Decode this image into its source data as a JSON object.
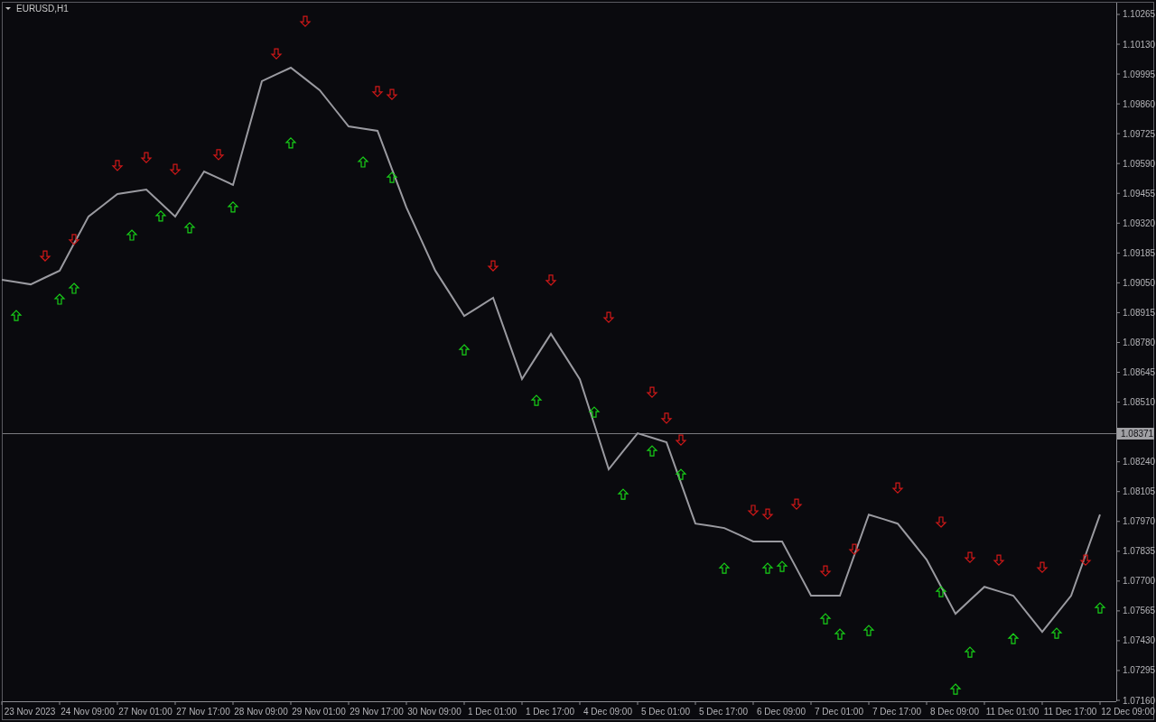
{
  "chart": {
    "chart_data": {
      "type": "line",
      "title": "EURUSD,H1",
      "categories": [
        null,
        null,
        "23 Nov 2023",
        null,
        null,
        null,
        "24 Nov 09:00",
        null,
        null,
        null,
        "27 Nov 01:00",
        null,
        null,
        null,
        "27 Nov 17:00",
        null,
        null,
        null,
        "28 Nov 09:00",
        null,
        null,
        null,
        "29 Nov 01:00",
        null,
        null,
        null,
        "29 Nov 17:00",
        null,
        null,
        null,
        "30 Nov 09:00",
        null,
        null,
        null,
        "1 Dec 01:00",
        null,
        null,
        null,
        "1 Dec 17:00",
        null,
        null,
        null,
        "4 Dec 09:00",
        null,
        null,
        null,
        "5 Dec 01:00",
        null,
        null,
        null,
        "5 Dec 17:00",
        null,
        null,
        null,
        "6 Dec 09:00",
        null,
        null,
        null,
        "7 Dec 01:00",
        null,
        null,
        null,
        "7 Dec 17:00",
        null,
        null,
        null,
        "8 Dec 09:00",
        null,
        null,
        null,
        "11 Dec 01:00",
        null,
        null,
        null,
        "11 Dec 17:00",
        null,
        null,
        null,
        "12 Dec 09:00"
      ],
      "series": [
        {
          "color": "#9a9aa0",
          "values": [
            1.09064,
            1.09054,
            1.09043,
            1.09074,
            1.09105,
            1.09228,
            1.0935,
            1.09401,
            1.09452,
            1.09462,
            1.09472,
            1.09411,
            1.0935,
            1.09452,
            1.09554,
            1.09524,
            1.09493,
            1.09728,
            1.09963,
            1.09994,
            1.10024,
            1.09973,
            1.09922,
            1.0984,
            1.09758,
            1.09748,
            1.09738,
            1.09565,
            1.09391,
            1.09248,
            1.09105,
            1.09003,
            1.089,
            1.08941,
            1.08982,
            1.08798,
            1.08614,
            1.08717,
            1.08819,
            1.08717,
            1.08614,
            1.0841,
            1.08206,
            1.08288,
            1.08369,
            1.08349,
            1.08328,
            1.08144,
            1.0796,
            1.0795,
            1.0794,
            1.0791,
            1.07879,
            1.07879,
            1.07879,
            1.07757,
            1.07634,
            1.07634,
            1.07634,
            1.07818,
            1.08001,
            1.07981,
            1.0796,
            1.07879,
            1.07797,
            1.07675,
            1.07552,
            1.07613,
            1.07674,
            1.07654,
            1.07634,
            1.07552,
            1.0747,
            1.07552,
            1.07634,
            1.07818,
            1.08001,
            null,
            null
          ]
        },
        {
          "type": "scatter",
          "color": "#d01818",
          "values": [
            null,
            null,
            null,
            1.09174,
            null,
            1.09248,
            null,
            null,
            1.09583,
            null,
            1.09619,
            null,
            1.09566,
            null,
            null,
            1.09632,
            null,
            null,
            null,
            1.10089,
            null,
            1.10236,
            null,
            null,
            null,
            null,
            1.09918,
            1.09905,
            null,
            null,
            null,
            null,
            null,
            null,
            1.09129,
            null,
            null,
            null,
            1.09064,
            null,
            null,
            null,
            1.08896,
            null,
            null,
            1.08557,
            1.08439,
            1.0834,
            null,
            null,
            null,
            null,
            1.08022,
            1.08005,
            null,
            1.0805,
            null,
            1.07748,
            null,
            1.07846,
            null,
            null,
            1.08124,
            null,
            null,
            1.07969,
            null,
            1.07809,
            null,
            1.07797,
            null,
            null,
            1.07764,
            null,
            null,
            1.07797,
            null,
            null,
            null
          ]
        },
        {
          "type": "scatter",
          "color": "#18d018",
          "values": [
            null,
            1.089,
            null,
            null,
            1.08974,
            1.09023,
            null,
            null,
            null,
            1.09264,
            null,
            1.0935,
            null,
            1.09297,
            null,
            null,
            1.09391,
            null,
            null,
            null,
            1.09681,
            null,
            null,
            null,
            null,
            1.09595,
            null,
            1.09525,
            null,
            null,
            null,
            null,
            1.08745,
            null,
            null,
            null,
            null,
            1.08516,
            null,
            null,
            null,
            1.08463,
            null,
            1.08091,
            null,
            1.08287,
            null,
            1.08181,
            null,
            null,
            1.07756,
            null,
            null,
            1.07756,
            1.07764,
            null,
            null,
            1.07527,
            1.07458,
            null,
            1.07474,
            null,
            null,
            null,
            null,
            1.0765,
            1.07209,
            1.07376,
            null,
            null,
            1.07437,
            null,
            null,
            1.07462,
            null,
            null,
            1.07576,
            null,
            null
          ]
        }
      ],
      "ylim": [
        1.07156,
        1.10318
      ],
      "yticks": [
        {
          "value": 1.10265,
          "label": "1.10265"
        },
        {
          "value": 1.1013,
          "label": "1.10130"
        },
        {
          "value": 1.09995,
          "label": "1.09995"
        },
        {
          "value": 1.0986,
          "label": "1.09860"
        },
        {
          "value": 1.09725,
          "label": "1.09725"
        },
        {
          "value": 1.0959,
          "label": "1.09590"
        },
        {
          "value": 1.09455,
          "label": "1.09455"
        },
        {
          "value": 1.0932,
          "label": "1.09320"
        },
        {
          "value": 1.09185,
          "label": "1.09185"
        },
        {
          "value": 1.0905,
          "label": "1.09050"
        },
        {
          "value": 1.08915,
          "label": "1.08915"
        },
        {
          "value": 1.0878,
          "label": "1.08780"
        },
        {
          "value": 1.08645,
          "label": "1.08645"
        },
        {
          "value": 1.0851,
          "label": "1.08510"
        },
        {
          "value": 1.0824,
          "label": "1.08240"
        },
        {
          "value": 1.08105,
          "label": "1.08105"
        },
        {
          "value": 1.0797,
          "label": "1.07970"
        },
        {
          "value": 1.07835,
          "label": "1.07835"
        },
        {
          "value": 1.077,
          "label": "1.07700"
        },
        {
          "value": 1.07565,
          "label": "1.07565"
        },
        {
          "value": 1.0743,
          "label": "1.07430"
        },
        {
          "value": 1.07295,
          "label": "1.07295"
        },
        {
          "value": 1.0716,
          "label": "1.07160"
        }
      ],
      "ref_lines": [
        {
          "axis": "y",
          "value": 1.08371,
          "label": "1.08371"
        }
      ]
    }
  }
}
